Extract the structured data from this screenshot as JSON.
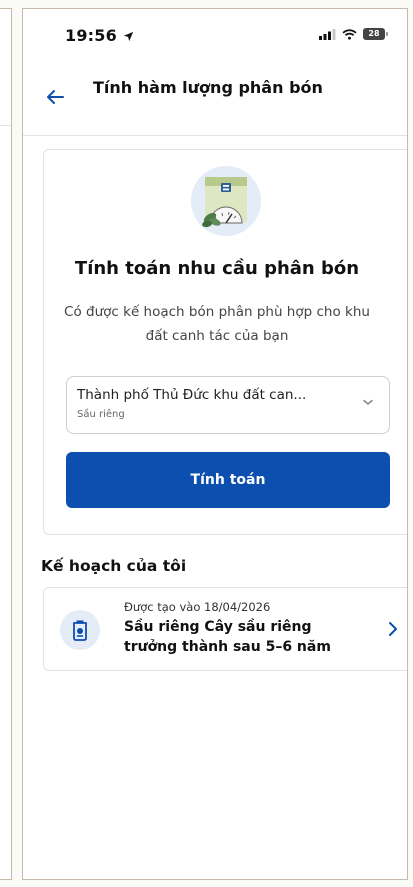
{
  "status": {
    "time": "19:56",
    "battery": "28"
  },
  "header": {
    "title": "Tính hàm lượng phân bón"
  },
  "calculator": {
    "title": "Tính toán nhu cầu phân bón",
    "description": "Có được kế hoạch bón phân phù hợp cho khu đất canh tác của bạn",
    "select": {
      "value": "Thành phố Thủ Đức khu đất can...",
      "subvalue": "Sầu riêng"
    },
    "button_label": "Tính toán"
  },
  "plans": {
    "heading": "Kế hoạch của tôi",
    "items": [
      {
        "created": "Được tạo vào 18/04/2026",
        "title": "Sầu riêng Cây sầu riêng trưởng thành sau 5–6 năm"
      }
    ]
  },
  "colors": {
    "primary": "#0d4fae",
    "icon_bg": "#e4ecf7",
    "border": "#e3e3e3"
  },
  "icons": [
    "back-arrow-icon",
    "signal-icon",
    "wifi-icon",
    "battery-icon",
    "fertilizer-bag-icon",
    "chevron-down-icon",
    "plan-bag-icon",
    "chevron-right-icon"
  ]
}
